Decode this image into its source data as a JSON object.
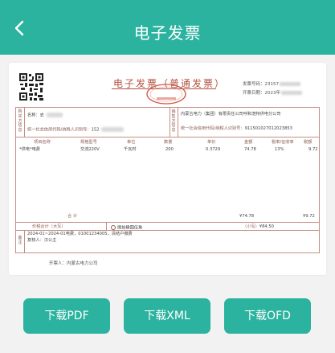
{
  "header": {
    "title": "电子发票",
    "back_icon": "back-arrow-icon"
  },
  "invoice": {
    "title": "电子发票（普通发票）",
    "seal_text": "全国统一发票监制",
    "meta": {
      "number_label": "发票号码：",
      "number_value": "23157",
      "date_label": "开票日期：",
      "date_value": "2023年"
    },
    "buyer": {
      "section_label": "购买方信息",
      "name_label": "名称：",
      "name_value": "史",
      "taxid_label": "统一社会信用代码/纳税人识别号：",
      "taxid_value": "152"
    },
    "seller": {
      "section_label": "销售方信息",
      "name_label": "名称：",
      "name_value": "内蒙古电力（集团）有限责任公司呼和浩特供电分公司",
      "taxid_label": "统一社会信用代码/纳税人识别号：",
      "taxid_value": "911501027012023853"
    },
    "columns": [
      "项目名称",
      "规格型号",
      "单位",
      "数量",
      "单价",
      "金额",
      "税率/征收率",
      "税额"
    ],
    "items": [
      {
        "name": "*供电*电费",
        "spec": "交流220V",
        "unit": "千瓦时",
        "qty": "200",
        "price": "0.3729",
        "amount": "74.78",
        "rate": "13%",
        "tax": "9.72"
      }
    ],
    "total_label": "合    计",
    "total_amount": "¥74.78",
    "total_tax": "¥9.72",
    "grand_total_label": "价税合计（大写）",
    "grand_total_words": "捌拾肆圆伍角",
    "grand_total_small_label": "（小写）",
    "grand_total_small": "¥84.50",
    "remarks_label": "备注",
    "remarks_line1": "2024-01~2024-01电费，01001234005，清结户缴费",
    "remarks_line2": "复核人：汉公主",
    "issuer_label": "开票人：",
    "issuer_value": "内蒙古电力公司"
  },
  "actions": [
    {
      "label": "下载PDF"
    },
    {
      "label": "下载XML"
    },
    {
      "label": "下载OFD"
    }
  ]
}
